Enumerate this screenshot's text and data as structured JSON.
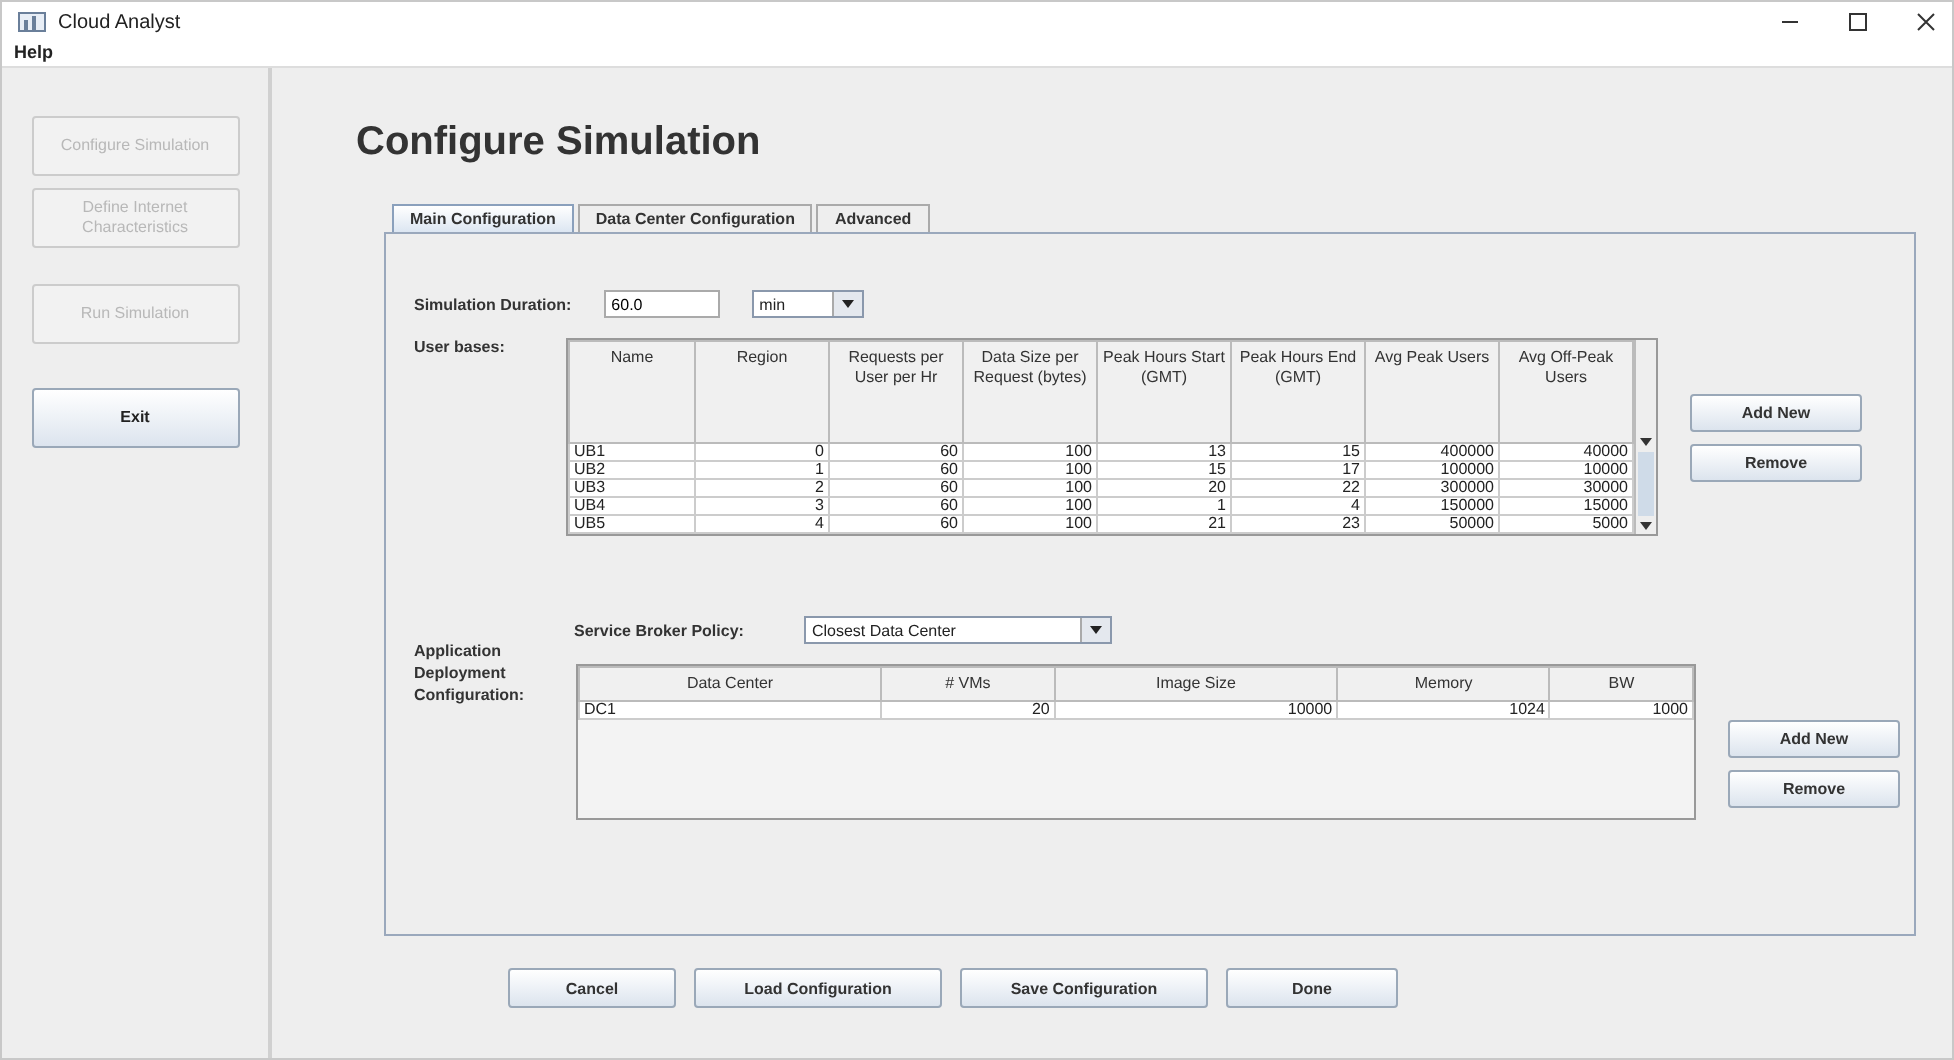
{
  "window": {
    "title": "Cloud Analyst"
  },
  "menu": [
    "Help"
  ],
  "sidebar": {
    "buttons": [
      {
        "label": "Configure Simulation",
        "disabled": true
      },
      {
        "label": "Define Internet Characteristics",
        "disabled": true
      },
      {
        "label": "Run Simulation",
        "disabled": true
      },
      {
        "label": "Exit",
        "disabled": false
      }
    ]
  },
  "heading": "Configure Simulation",
  "tabs": [
    {
      "label": "Main Configuration",
      "selected": true
    },
    {
      "label": "Data Center Configuration",
      "selected": false
    },
    {
      "label": "Advanced",
      "selected": false
    }
  ],
  "simulation_duration": {
    "label": "Simulation Duration:",
    "value": "60.0",
    "unit": "min"
  },
  "user_bases": {
    "label": "User bases:",
    "columns": [
      "Name",
      "Region",
      "Requests per User per Hr",
      "Data Size per Request (bytes)",
      "Peak Hours Start (GMT)",
      "Peak Hours End (GMT)",
      "Avg Peak Users",
      "Avg Off-Peak Users"
    ],
    "rows": [
      [
        "UB1",
        "0",
        "60",
        "100",
        "13",
        "15",
        "400000",
        "40000"
      ],
      [
        "UB2",
        "1",
        "60",
        "100",
        "15",
        "17",
        "100000",
        "10000"
      ],
      [
        "UB3",
        "2",
        "60",
        "100",
        "20",
        "22",
        "300000",
        "30000"
      ],
      [
        "UB4",
        "3",
        "60",
        "100",
        "1",
        "4",
        "150000",
        "15000"
      ],
      [
        "UB5",
        "4",
        "60",
        "100",
        "21",
        "23",
        "50000",
        "5000"
      ]
    ],
    "buttons": [
      "Add New",
      "Remove"
    ]
  },
  "deployment": {
    "label": "Application Deployment Configuration:",
    "broker_label": "Service Broker Policy:",
    "broker_value": "Closest Data Center",
    "columns": [
      "Data Center",
      "# VMs",
      "Image Size",
      "Memory",
      "BW"
    ],
    "rows": [
      [
        "DC1",
        "20",
        "10000",
        "1024",
        "1000"
      ]
    ],
    "buttons": [
      "Add New",
      "Remove"
    ]
  },
  "footer_buttons": [
    "Cancel",
    "Load Configuration",
    "Save Configuration",
    "Done"
  ]
}
